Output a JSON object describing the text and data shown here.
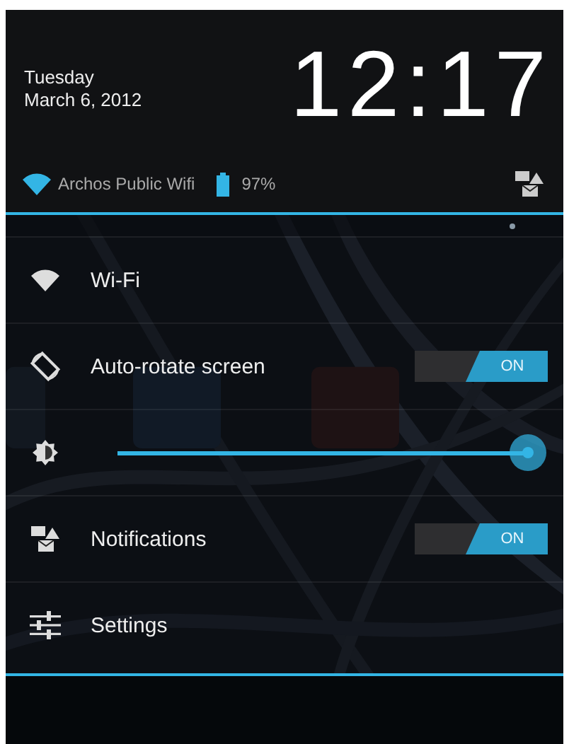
{
  "header": {
    "day": "Tuesday",
    "date": "March 6, 2012",
    "time": "12:17"
  },
  "status": {
    "network": "Archos Public Wifi",
    "battery": "97%"
  },
  "rows": [
    {
      "kind": "wifi",
      "label": "Wi-Fi"
    },
    {
      "kind": "rotate",
      "label": "Auto-rotate screen",
      "toggle": {
        "on": true,
        "label": "ON"
      }
    },
    {
      "kind": "brightness",
      "level": 1.0
    },
    {
      "kind": "notifications",
      "label": "Notifications",
      "toggle": {
        "on": true,
        "label": "ON"
      }
    },
    {
      "kind": "settings",
      "label": "Settings"
    }
  ]
}
